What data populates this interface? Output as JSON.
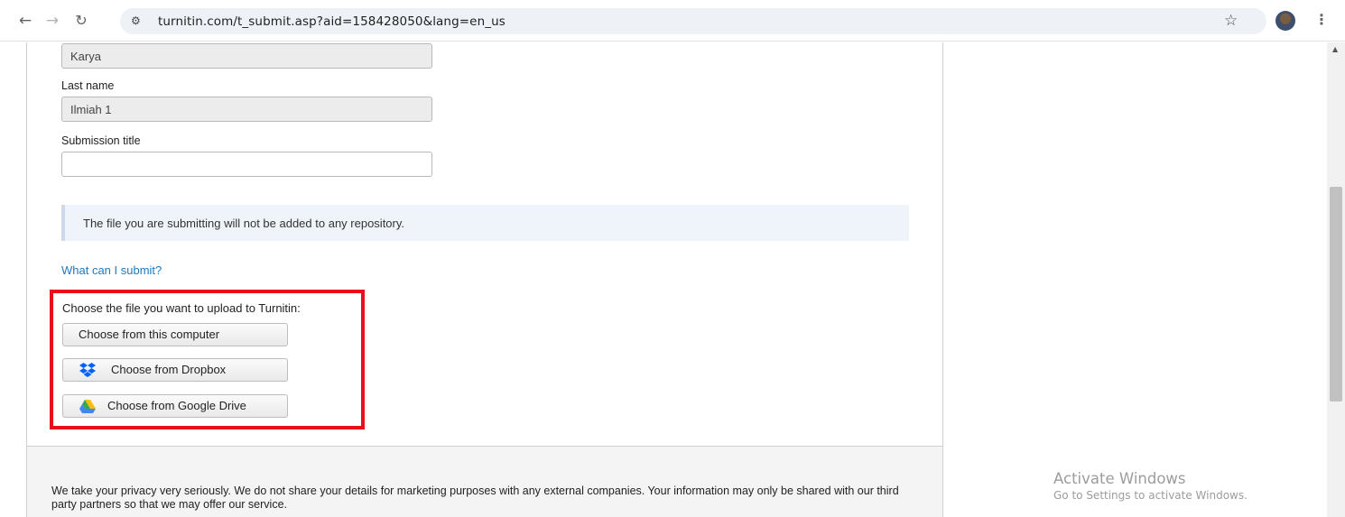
{
  "browser": {
    "url": "turnitin.com/t_submit.asp?aid=158428050&lang=en_us",
    "back_icon": "←",
    "forward_icon": "→",
    "reload_icon": "↻",
    "site_info_icon": "⚙",
    "star_icon": "☆",
    "menu_icon": "⋮"
  },
  "form": {
    "first_name_value": "Karya",
    "last_name_label": "Last name",
    "last_name_value": "Ilmiah 1",
    "title_label": "Submission title",
    "title_value": ""
  },
  "notice": {
    "text": "The file you are submitting will not be added to any repository."
  },
  "help_link": "What can I submit?",
  "upload": {
    "title": "Choose the file you want to upload to Turnitin:",
    "computer_label": "Choose from this computer",
    "dropbox_label": "Choose from Dropbox",
    "gdrive_label": "Choose from Google Drive",
    "highlight_color": "#e8101b"
  },
  "footer": {
    "privacy_text": "We take your privacy very seriously. We do not share your details for marketing purposes with any external companies. Your information may only be shared with our third party partners so that we may offer our service."
  },
  "watermark": {
    "title": "Activate Windows",
    "subtitle": "Go to Settings to activate Windows."
  }
}
